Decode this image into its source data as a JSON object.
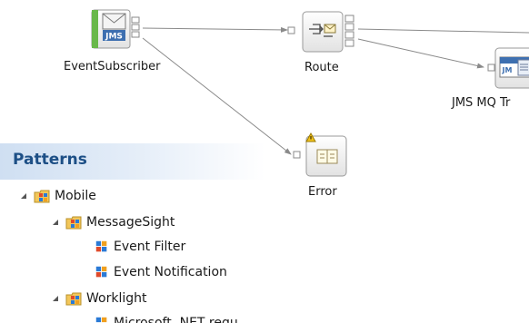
{
  "flow": {
    "nodes": {
      "event_subscriber": {
        "label": "EventSubscriber",
        "icon": "jms-input-icon",
        "icon_text": "JMS"
      },
      "route": {
        "label": "Route",
        "icon": "route-icon"
      },
      "jms_mq": {
        "label": "JMS MQ Tr",
        "icon": "jms-mq-transformer-icon",
        "icon_text": "JM"
      },
      "error": {
        "label": "Error",
        "icon": "error-node-icon",
        "has_warning": true
      }
    }
  },
  "patterns": {
    "title": "Patterns",
    "tree": {
      "mobile": {
        "label": "Mobile",
        "icon": "pattern-folder-icon",
        "expanded": true
      },
      "messagesight": {
        "label": "MessageSight",
        "icon": "pattern-folder-icon",
        "expanded": true
      },
      "event_filter": {
        "label": "Event Filter",
        "icon": "pattern-icon"
      },
      "event_notification": {
        "label": "Event Notification",
        "icon": "pattern-icon"
      },
      "worklight": {
        "label": "Worklight",
        "icon": "pattern-folder-icon",
        "expanded": true
      },
      "microsoft_net": {
        "label": "Microsoft .NET requ",
        "icon": "pattern-icon"
      }
    }
  },
  "colors": {
    "panel_title": "#1d4f86",
    "connector": "#808080",
    "node_border": "#9a9a9a",
    "jms_blue": "#3d6fb0",
    "input_green": "#69b84a"
  }
}
